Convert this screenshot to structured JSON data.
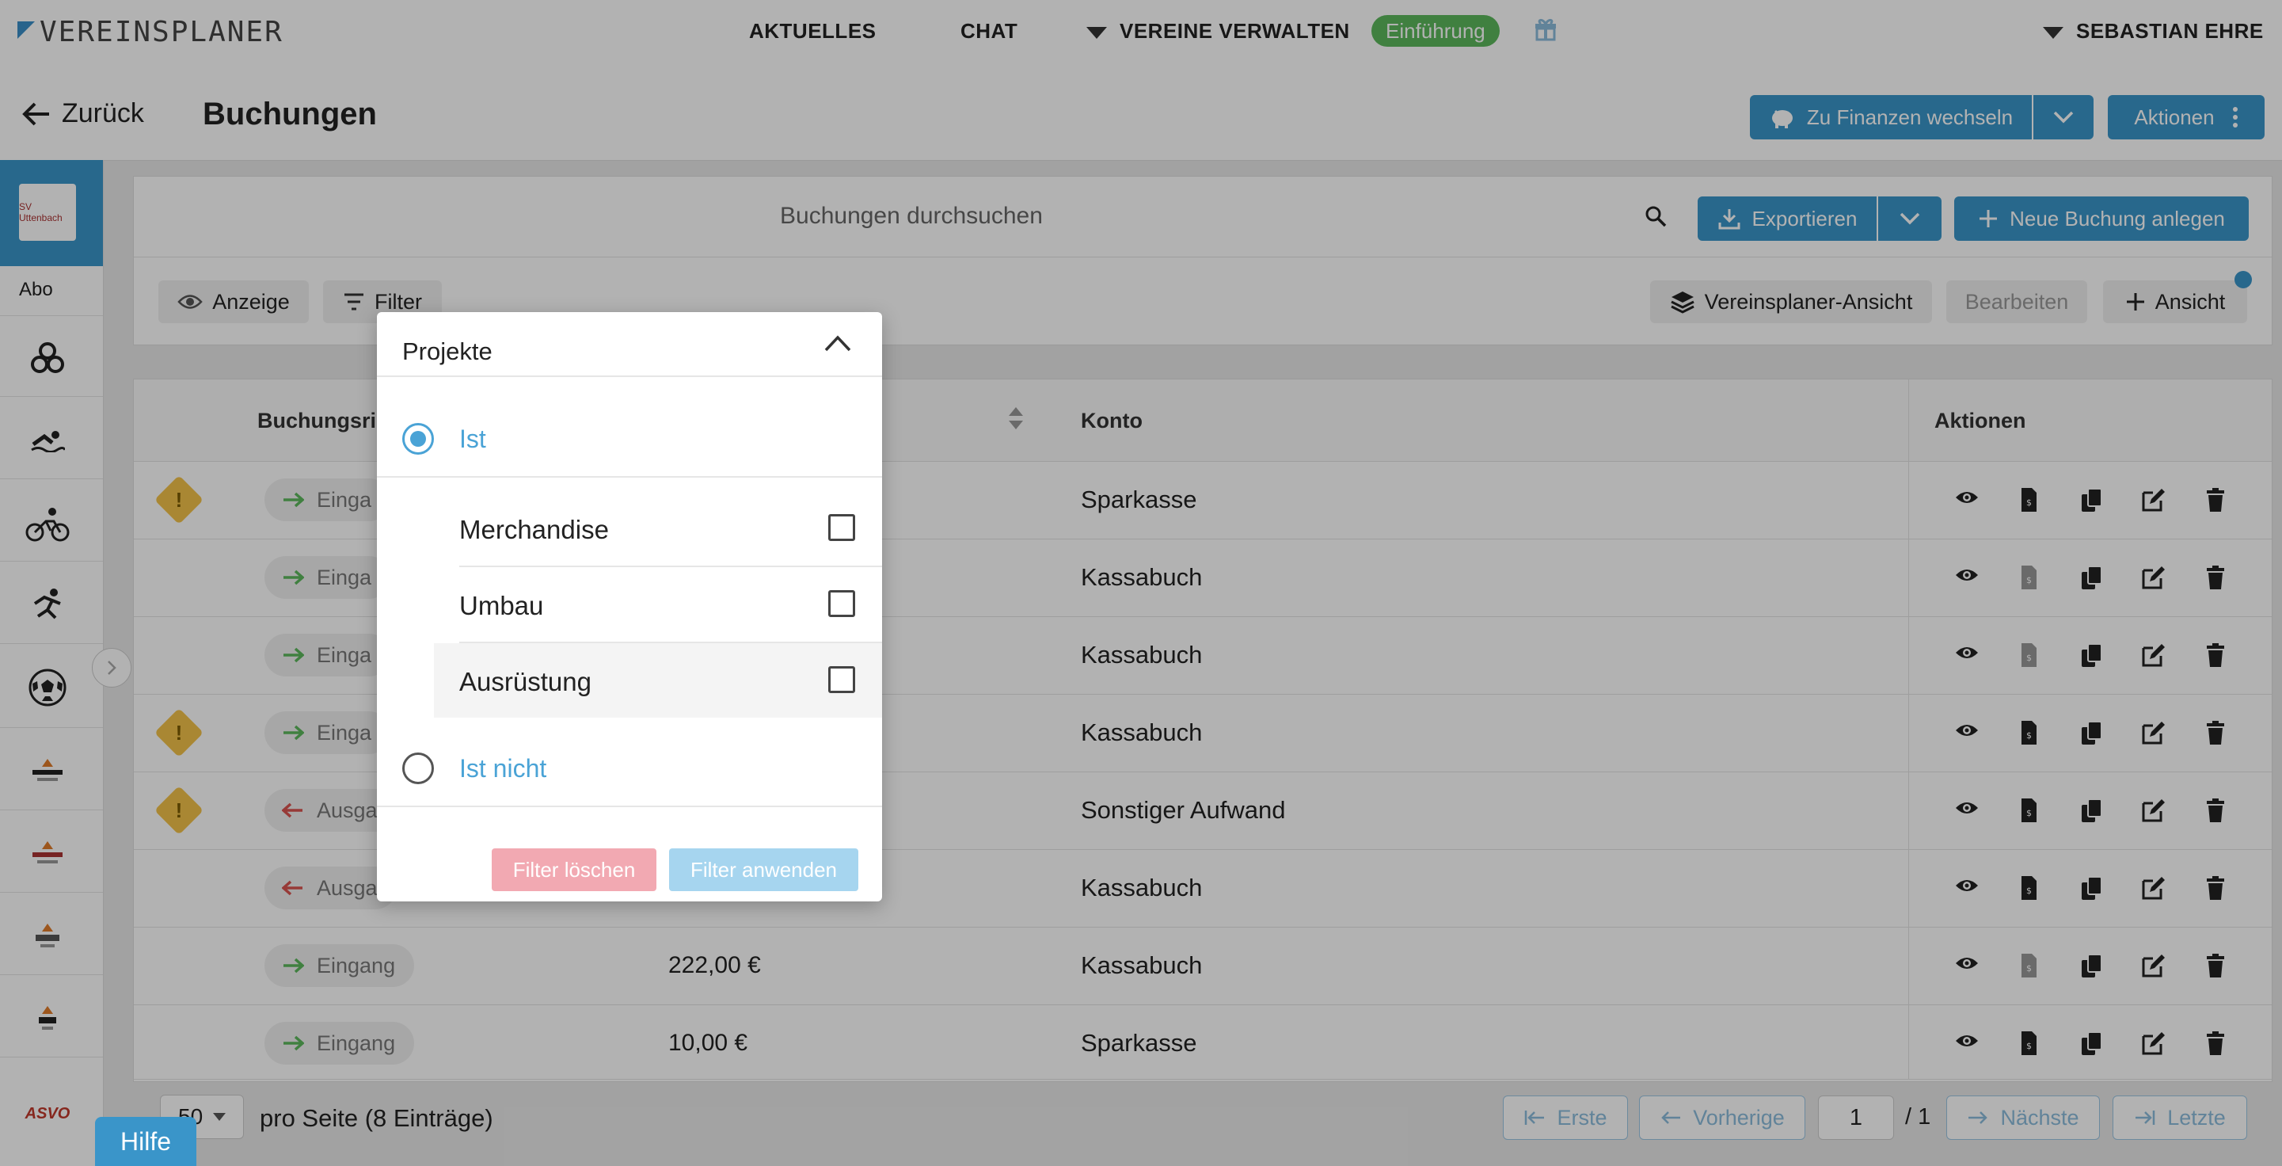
{
  "topnav": {
    "logo_text": "VEREINSPLANER",
    "aktuelles": "AKTUELLES",
    "chat": "CHAT",
    "vereine": "VEREINE VERWALTEN",
    "einfuehrung": "Einführung",
    "user": "SEBASTIAN EHRE"
  },
  "header": {
    "back": "Zurück",
    "title": "Buchungen",
    "finanzen": "Zu Finanzen wechseln",
    "aktionen": "Aktionen"
  },
  "sidebar": {
    "club_name": "SV Uttenbach",
    "abo": "Abo",
    "bottom_logo": "ASVO"
  },
  "toolbar": {
    "search_placeholder": "Buchungen durchsuchen",
    "exportieren": "Exportieren",
    "neue_buchung": "Neue Buchung anlegen",
    "anzeige": "Anzeige",
    "filter": "Filter",
    "vereinsplaner_ansicht": "Vereinsplaner-Ansicht",
    "bearbeiten": "Bearbeiten",
    "ansicht": "Ansicht"
  },
  "table": {
    "headers": {
      "richtung": "Buchungsri",
      "konto": "Konto",
      "aktionen": "Aktionen"
    },
    "rows": [
      {
        "direction": "Einga",
        "type": "in",
        "amount": "",
        "konto": "Sparkasse",
        "warn": true,
        "doc_active": true
      },
      {
        "direction": "Einga",
        "type": "in",
        "amount": "",
        "konto": "Kassabuch",
        "warn": false,
        "doc_active": false
      },
      {
        "direction": "Einga",
        "type": "in",
        "amount": "",
        "konto": "Kassabuch",
        "warn": false,
        "doc_active": false
      },
      {
        "direction": "Einga",
        "type": "in",
        "amount": "",
        "konto": "Kassabuch",
        "warn": true,
        "doc_active": true
      },
      {
        "direction": "Ausga",
        "type": "out",
        "amount": "",
        "konto": "Sonstiger Aufwand",
        "warn": true,
        "doc_active": true
      },
      {
        "direction": "Ausga",
        "type": "out",
        "amount": "",
        "konto": "Kassabuch",
        "warn": false,
        "doc_active": true
      },
      {
        "direction": "Eingang",
        "type": "in",
        "amount": "222,00 €",
        "konto": "Kassabuch",
        "warn": false,
        "doc_active": false
      },
      {
        "direction": "Eingang",
        "type": "in",
        "amount": "10,00 €",
        "konto": "Sparkasse",
        "warn": false,
        "doc_active": true
      }
    ]
  },
  "pagination": {
    "per_page_value": "50",
    "per_page_text": "pro Seite (8 Einträge)",
    "erste": "Erste",
    "vorherige": "Vorherige",
    "page": "1",
    "total": "/ 1",
    "naechste": "Nächste",
    "letzte": "Letzte"
  },
  "hilfe": "Hilfe",
  "filter_dropdown": {
    "title": "Projekte",
    "ist": "Ist",
    "ist_nicht": "Ist nicht",
    "selected": "Ist",
    "options": [
      {
        "label": "Merchandise",
        "checked": false
      },
      {
        "label": "Umbau",
        "checked": false
      },
      {
        "label": "Ausrüstung",
        "checked": false
      }
    ],
    "clear": "Filter löschen",
    "apply": "Filter anwenden"
  },
  "colors": {
    "accent": "#3a95c9",
    "success": "#5cb85c",
    "warning": "#f3c24a",
    "danger_light": "#f2a9b2"
  }
}
